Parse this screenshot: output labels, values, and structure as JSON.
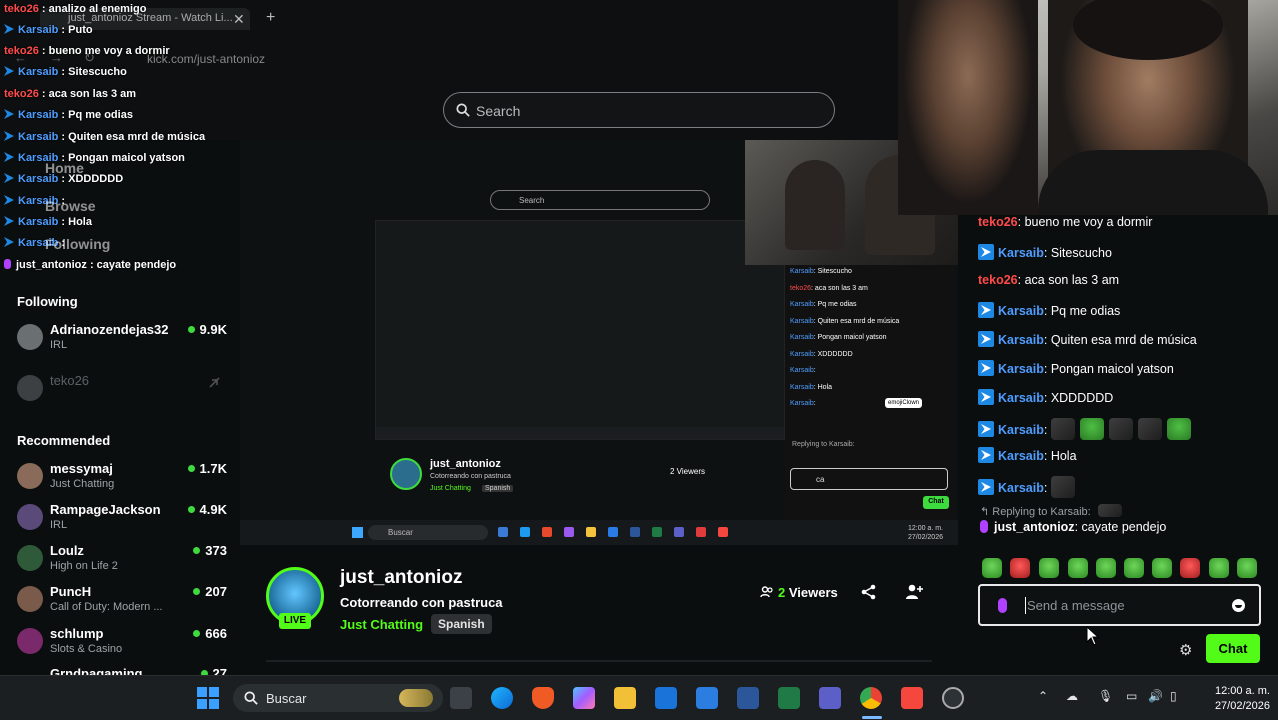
{
  "browser": {
    "tab_title": "just_antonioz Stream - Watch Li...",
    "url": "kick.com/just-antonioz",
    "search_placeholder": "Search"
  },
  "overlay_chat": [
    {
      "user": "teko26",
      "color": "red",
      "badge": "none",
      "text": "analizo al enemigo"
    },
    {
      "user": "Karsaib",
      "color": "blue",
      "badge": "kick",
      "text": "Puto"
    },
    {
      "user": "teko26",
      "color": "red",
      "badge": "none",
      "text": "bueno me voy a dormir"
    },
    {
      "user": "Karsaib",
      "color": "blue",
      "badge": "kick",
      "text": "Sitescucho"
    },
    {
      "user": "teko26",
      "color": "red",
      "badge": "none",
      "text": "aca son las 3 am"
    },
    {
      "user": "Karsaib",
      "color": "blue",
      "badge": "kick",
      "text": "Pq me odias"
    },
    {
      "user": "Karsaib",
      "color": "blue",
      "badge": "kick",
      "text": "Quiten esa mrd de música"
    },
    {
      "user": "Karsaib",
      "color": "blue",
      "badge": "kick",
      "text": "Pongan maicol yatson"
    },
    {
      "user": "Karsaib",
      "color": "blue",
      "badge": "kick",
      "text": "XDDDDDD"
    },
    {
      "user": "Karsaib",
      "color": "blue",
      "badge": "kick",
      "text": ""
    },
    {
      "user": "Karsaib",
      "color": "blue",
      "badge": "kick",
      "text": "Hola"
    },
    {
      "user": "Karsaib",
      "color": "blue",
      "badge": "kick",
      "text": ""
    },
    {
      "user": "just_antonioz",
      "color": "white",
      "badge": "mic",
      "text": "cayate pendejo"
    }
  ],
  "ghost_nav": [
    "Home",
    "Browse",
    "Following"
  ],
  "sidebar": {
    "following_heading": "Following",
    "following": [
      {
        "name": "Adrianozendejas32",
        "sub": "IRL",
        "count": "9.9K",
        "live": true
      },
      {
        "name": "teko26",
        "sub": "",
        "count": "",
        "live": false
      }
    ],
    "recommended_heading": "Recommended",
    "recommended": [
      {
        "name": "messymaj",
        "sub": "Just Chatting",
        "count": "1.7K"
      },
      {
        "name": "RampageJackson",
        "sub": "IRL",
        "count": "4.9K"
      },
      {
        "name": "Loulz",
        "sub": "High on Life 2",
        "count": "373"
      },
      {
        "name": "PuncH",
        "sub": "Call of Duty: Modern ...",
        "count": "207"
      },
      {
        "name": "schlump",
        "sub": "Slots & Casino",
        "count": "666"
      },
      {
        "name": "Grndpagaming",
        "sub": "",
        "count": "27"
      }
    ]
  },
  "stream": {
    "nested_chat": [
      {
        "user": "Karsaib",
        "color": "blue",
        "text": "Sitescucho"
      },
      {
        "user": "teko26",
        "color": "red",
        "text": "aca son las 3 am"
      },
      {
        "user": "Karsaib",
        "color": "blue",
        "text": "Pq me odias"
      },
      {
        "user": "Karsaib",
        "color": "blue",
        "text": "Quiten esa mrd de música"
      },
      {
        "user": "Karsaib",
        "color": "blue",
        "text": "Pongan maicol yatson"
      },
      {
        "user": "Karsaib",
        "color": "blue",
        "text": "XDDDDDD"
      },
      {
        "user": "Karsaib",
        "color": "blue",
        "text": ""
      },
      {
        "user": "Karsaib",
        "color": "blue",
        "text": "Hola"
      },
      {
        "user": "Karsaib",
        "color": "blue",
        "text": ""
      }
    ],
    "nested_reply": "Replying to Karsaib:",
    "nested_input_value": "ca",
    "nested_chat_button": "Chat",
    "nested_tooltip": "emojiClown",
    "nested_streamer": "just_antonioz",
    "nested_title": "Cotorreando con pastruca",
    "nested_category": "Just Chatting",
    "nested_tag": "Spanish",
    "nested_viewers": "2 Viewers",
    "nested_search": "Search",
    "nested_taskbar_search": "Buscar",
    "nested_time": "12:00 a. m.",
    "nested_date": "27/02/2026"
  },
  "chat": {
    "messages": [
      {
        "user": "teko26",
        "color": "red",
        "badge": "none",
        "text": "bueno me voy a dormir"
      },
      {
        "user": "Karsaib",
        "color": "blue",
        "badge": "kick",
        "text": "Sitescucho"
      },
      {
        "user": "teko26",
        "color": "red",
        "badge": "none",
        "text": "aca son las 3 am"
      },
      {
        "user": "Karsaib",
        "color": "blue",
        "badge": "kick",
        "text": "Pq me odias"
      },
      {
        "user": "Karsaib",
        "color": "blue",
        "badge": "kick",
        "text": "Quiten esa mrd de música"
      },
      {
        "user": "Karsaib",
        "color": "blue",
        "badge": "kick",
        "text": "Pongan maicol yatson"
      },
      {
        "user": "Karsaib",
        "color": "blue",
        "badge": "kick",
        "text": "XDDDDDD"
      },
      {
        "user": "Karsaib",
        "color": "blue",
        "badge": "kick",
        "text": "",
        "emotes": [
          "dark",
          "frog",
          "dark",
          "dark",
          "frog"
        ]
      },
      {
        "user": "Karsaib",
        "color": "blue",
        "badge": "kick",
        "text": "Hola"
      },
      {
        "user": "Karsaib",
        "color": "blue",
        "badge": "kick",
        "text": "",
        "emotes": [
          "dark"
        ]
      }
    ],
    "reply_label": "Replying to Karsaib:",
    "reply_message": {
      "user": "just_antonioz",
      "text": "cayate pendejo"
    },
    "input_placeholder": "Send a message",
    "chat_button": "Chat"
  },
  "stream_info": {
    "streamer": "just_antonioz",
    "live_label": "LIVE",
    "title": "Cotorreando con pastruca",
    "category": "Just Chatting",
    "tag": "Spanish",
    "viewers_count": "2",
    "viewers_label": "Viewers"
  },
  "taskbar": {
    "search_label": "Buscar",
    "time": "12:00 a. m.",
    "date": "27/02/2026"
  },
  "colors": {
    "kick_green": "#53fc18",
    "username_red": "#ff4b4b",
    "username_blue": "#4f9dff",
    "mic_purple": "#b042ff"
  }
}
